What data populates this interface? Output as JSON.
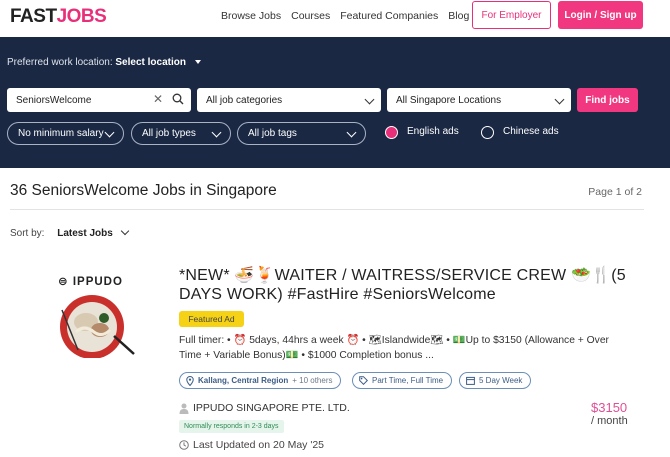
{
  "header": {
    "logo_part1": "FAST",
    "logo_part2": "JOBS",
    "nav": [
      "Browse Jobs",
      "Courses",
      "Featured Companies",
      "Blog"
    ],
    "employer_btn": "For Employer",
    "login_btn": "Login / Sign up"
  },
  "search": {
    "pref_label": "Preferred work location:",
    "pref_value": "Select location",
    "keyword_value": "SeniorsWelcome",
    "categories": "All job categories",
    "locations": "All Singapore Locations",
    "find_btn": "Find jobs",
    "salary": "No minimum salary",
    "job_types": "All job types",
    "job_tags": "All job tags",
    "lang_english": "English ads",
    "lang_chinese": "Chinese ads",
    "selected_lang": "English ads"
  },
  "results": {
    "title": "36 SeniorsWelcome Jobs in Singapore",
    "page": "Page 1 of 2",
    "sort_label": "Sort by:",
    "sort_value": "Latest Jobs"
  },
  "job": {
    "company_logo_text": "IPPUDO",
    "title": "*NEW* 🍜🍹WAITER / WAITRESS/SERVICE CREW 🥗🍴(5 DAYS WORK) #FastHire #SeniorsWelcome",
    "featured": "Featured Ad",
    "description": "Full timer: • ⏰ 5days, 44hrs a week ⏰ • 🗺Islandwide🗺 • 💵Up to $3150 (Allowance + Over Time + Variable Bonus)💵 • $1000 Completion bonus ...",
    "location": "Kallang, Central Region",
    "location_more": "+ 10 others",
    "job_type": "Part Time, Full Time",
    "schedule": "5 Day Week",
    "company": "IPPUDO SINGAPORE PTE. LTD.",
    "responds": "Normally responds in 2-3 days",
    "updated": "Last Updated on 20 May '25",
    "salary": "$3150",
    "salary_period": "/ month"
  },
  "colors": {
    "brand_pink": "#f0377f",
    "search_bg": "#1a2844",
    "featured_yellow": "#f5d215",
    "salary_pink": "#e04f95"
  }
}
